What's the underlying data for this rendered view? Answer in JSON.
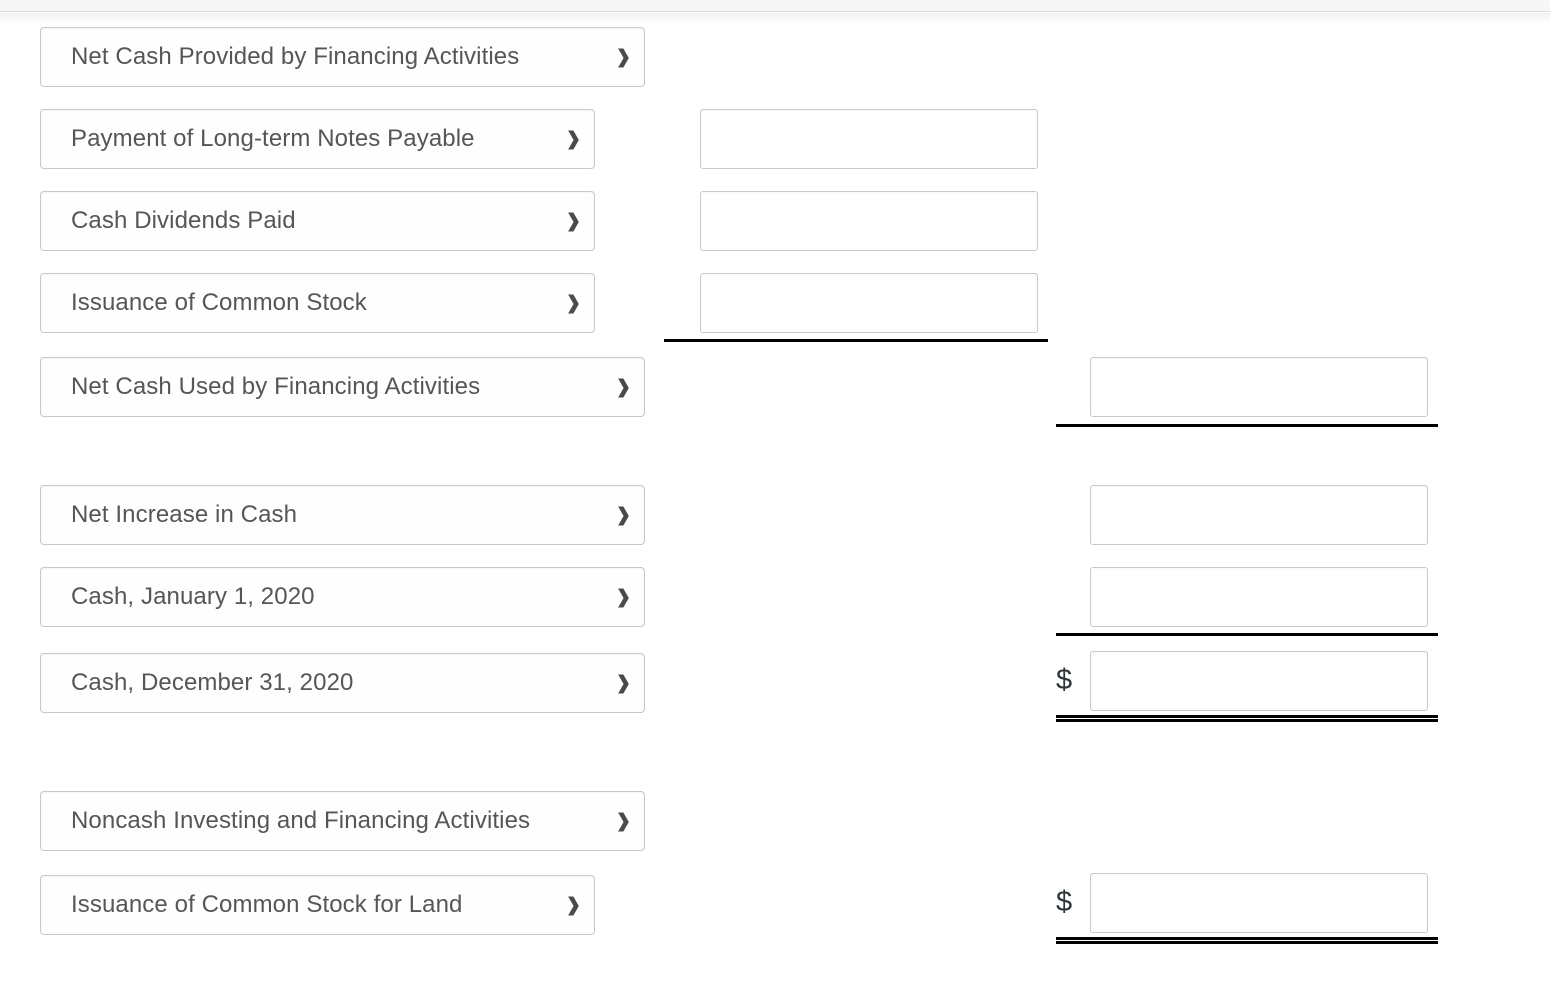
{
  "page": {
    "title": "Statement of Cash Flows — Financing Activities section",
    "background_color": "#ffffff",
    "text_color": "#565656",
    "border_color": "#c8c8c8",
    "rule_color": "#000000"
  },
  "rows": [
    {
      "key": "net-cash-provided-by-financing-activities",
      "select": {
        "value": "Net Cash Provided by Financing Activities",
        "icon": "chevron-down-icon"
      },
      "input_col": null,
      "dollar": null
    },
    {
      "key": "payment-of-long-term-notes-payable",
      "select": {
        "value": "Payment of Long-term Notes Payable",
        "icon": "chevron-down-icon"
      },
      "input_col": 2,
      "input_value": "",
      "dollar": null
    },
    {
      "key": "cash-dividends-paid",
      "select": {
        "value": "Cash Dividends Paid",
        "icon": "chevron-down-icon"
      },
      "input_col": 2,
      "input_value": "",
      "dollar": null
    },
    {
      "key": "issuance-of-common-stock",
      "select": {
        "value": "Issuance of Common Stock",
        "icon": "chevron-down-icon"
      },
      "input_col": 2,
      "input_value": "",
      "dollar": null
    },
    {
      "key": "net-cash-used-by-financing-activities",
      "select": {
        "value": "Net Cash Used by Financing Activities",
        "icon": "chevron-down-icon"
      },
      "input_col": 3,
      "input_value": "",
      "dollar": null
    },
    {
      "key": "net-increase-in-cash",
      "select": {
        "value": "Net Increase in Cash",
        "icon": "chevron-down-icon"
      },
      "input_col": 3,
      "input_value": "",
      "dollar": null
    },
    {
      "key": "cash-january-1-2020",
      "select": {
        "value": "Cash, January 1, 2020",
        "icon": "chevron-down-icon"
      },
      "input_col": 3,
      "input_value": "",
      "dollar": null
    },
    {
      "key": "cash-december-31-2020",
      "select": {
        "value": "Cash, December 31, 2020",
        "icon": "chevron-down-icon"
      },
      "input_col": 3,
      "input_value": "",
      "dollar": "$"
    },
    {
      "key": "noncash-investing-and-financing-activities",
      "select": {
        "value": "Noncash Investing and Financing Activities",
        "icon": "chevron-down-icon"
      },
      "input_col": null,
      "dollar": null
    },
    {
      "key": "issuance-of-common-stock-for-land",
      "select": {
        "value": "Issuance of Common Stock for Land",
        "icon": "chevron-down-icon"
      },
      "input_col": 3,
      "input_value": "",
      "dollar": "$"
    }
  ],
  "symbols": {
    "chevron_down": "⌄",
    "dollar_sign": "$"
  },
  "rules": [
    {
      "name": "subtotal-rule-financing-detail",
      "style": "single",
      "column": 2
    },
    {
      "name": "total-rule-net-cash-used-financing",
      "style": "single",
      "column": 3
    },
    {
      "name": "subtotal-rule-cash-january",
      "style": "single",
      "column": 3
    },
    {
      "name": "grand-total-rule-cash-december",
      "style": "double",
      "column": 3
    },
    {
      "name": "grand-total-rule-noncash",
      "style": "double",
      "column": 3
    }
  ],
  "inputs": {
    "placeholder": ""
  }
}
